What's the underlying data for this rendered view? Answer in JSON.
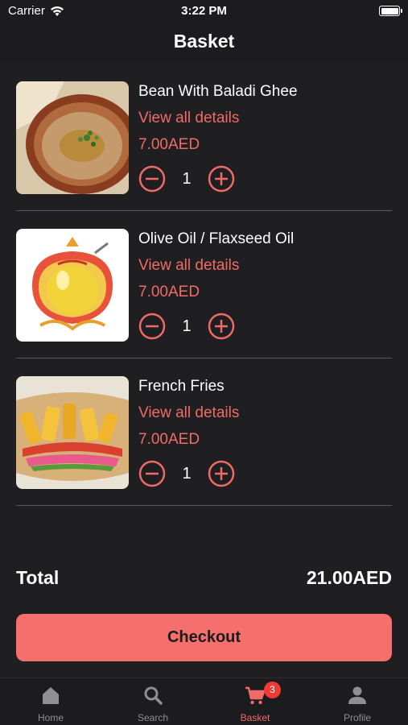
{
  "status_bar": {
    "carrier": "Carrier",
    "time": "3:22 PM"
  },
  "nav": {
    "title": "Basket"
  },
  "items": [
    {
      "name": "Bean With Baladi Ghee",
      "link": "View all details",
      "price": "7.00AED",
      "quantity": "1",
      "image_icon": "hummus-plate-image"
    },
    {
      "name": "Olive Oil / Flaxseed Oil",
      "link": "View all details",
      "price": "7.00AED",
      "quantity": "1",
      "image_icon": "olive-jar-image"
    },
    {
      "name": "French Fries",
      "link": "View all details",
      "price": "7.00AED",
      "quantity": "1",
      "image_icon": "fries-sandwich-image"
    }
  ],
  "total": {
    "label": "Total",
    "value": "21.00AED"
  },
  "checkout": {
    "label": "Checkout"
  },
  "tabs": [
    {
      "label": "Home",
      "icon": "home-icon"
    },
    {
      "label": "Search",
      "icon": "search-icon"
    },
    {
      "label": "Basket",
      "icon": "cart-icon",
      "badge": "3",
      "active": true
    },
    {
      "label": "Profile",
      "icon": "profile-icon"
    }
  ],
  "colors": {
    "accent": "#f06b68",
    "button": "#f56f6c",
    "background": "#1f1f21",
    "bar": "#1c1c1e",
    "badge": "#f03a35"
  }
}
